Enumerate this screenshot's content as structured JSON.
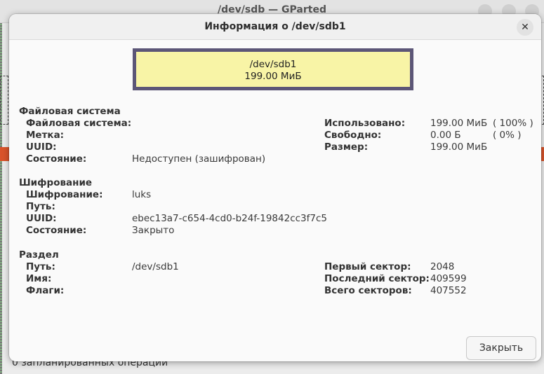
{
  "parent": {
    "title": "/dev/sdb — GParted",
    "status": "0 запланированных операций"
  },
  "dialog": {
    "title": "Информация о /dev/sdb1",
    "close_icon": "close-icon"
  },
  "graphic": {
    "name": "/dev/sdb1",
    "size": "199.00 МиБ",
    "border_color": "#5c5677",
    "fill_color": "#f8f4a6"
  },
  "filesystem": {
    "heading": "Файловая система",
    "labels": {
      "fs": "Файловая система:",
      "label": "Метка:",
      "uuid": "UUID:",
      "state": "Состояние:"
    },
    "values": {
      "fs": "",
      "label": "",
      "uuid": "",
      "state": "Недоступен (зашифрован)"
    },
    "usage": {
      "used_label": "Использовано:",
      "used_value": "199.00 МиБ",
      "used_pct": "( 100% )",
      "free_label": "Свободно:",
      "free_value": "0.00 Б",
      "free_pct": "( 0% )",
      "size_label": "Размер:",
      "size_value": "199.00 МиБ"
    }
  },
  "encryption": {
    "heading": "Шифрование",
    "labels": {
      "enc": "Шифрование:",
      "path": "Путь:",
      "uuid": "UUID:",
      "state": "Состояние:"
    },
    "values": {
      "enc": "luks",
      "path": "",
      "uuid": "ebec13a7-c654-4cd0-b24f-19842cc3f7c5",
      "state": "Закрыто"
    }
  },
  "partition": {
    "heading": "Раздел",
    "labels": {
      "path": "Путь:",
      "name": "Имя:",
      "flags": "Флаги:"
    },
    "values": {
      "path": "/dev/sdb1",
      "name": "",
      "flags": ""
    },
    "sectors": {
      "first_label": "Первый сектор:",
      "first_value": "2048",
      "last_label": "Последний сектор:",
      "last_value": "409599",
      "total_label": "Всего секторов:",
      "total_value": "407552"
    }
  },
  "buttons": {
    "close_label": "Закрыть"
  }
}
